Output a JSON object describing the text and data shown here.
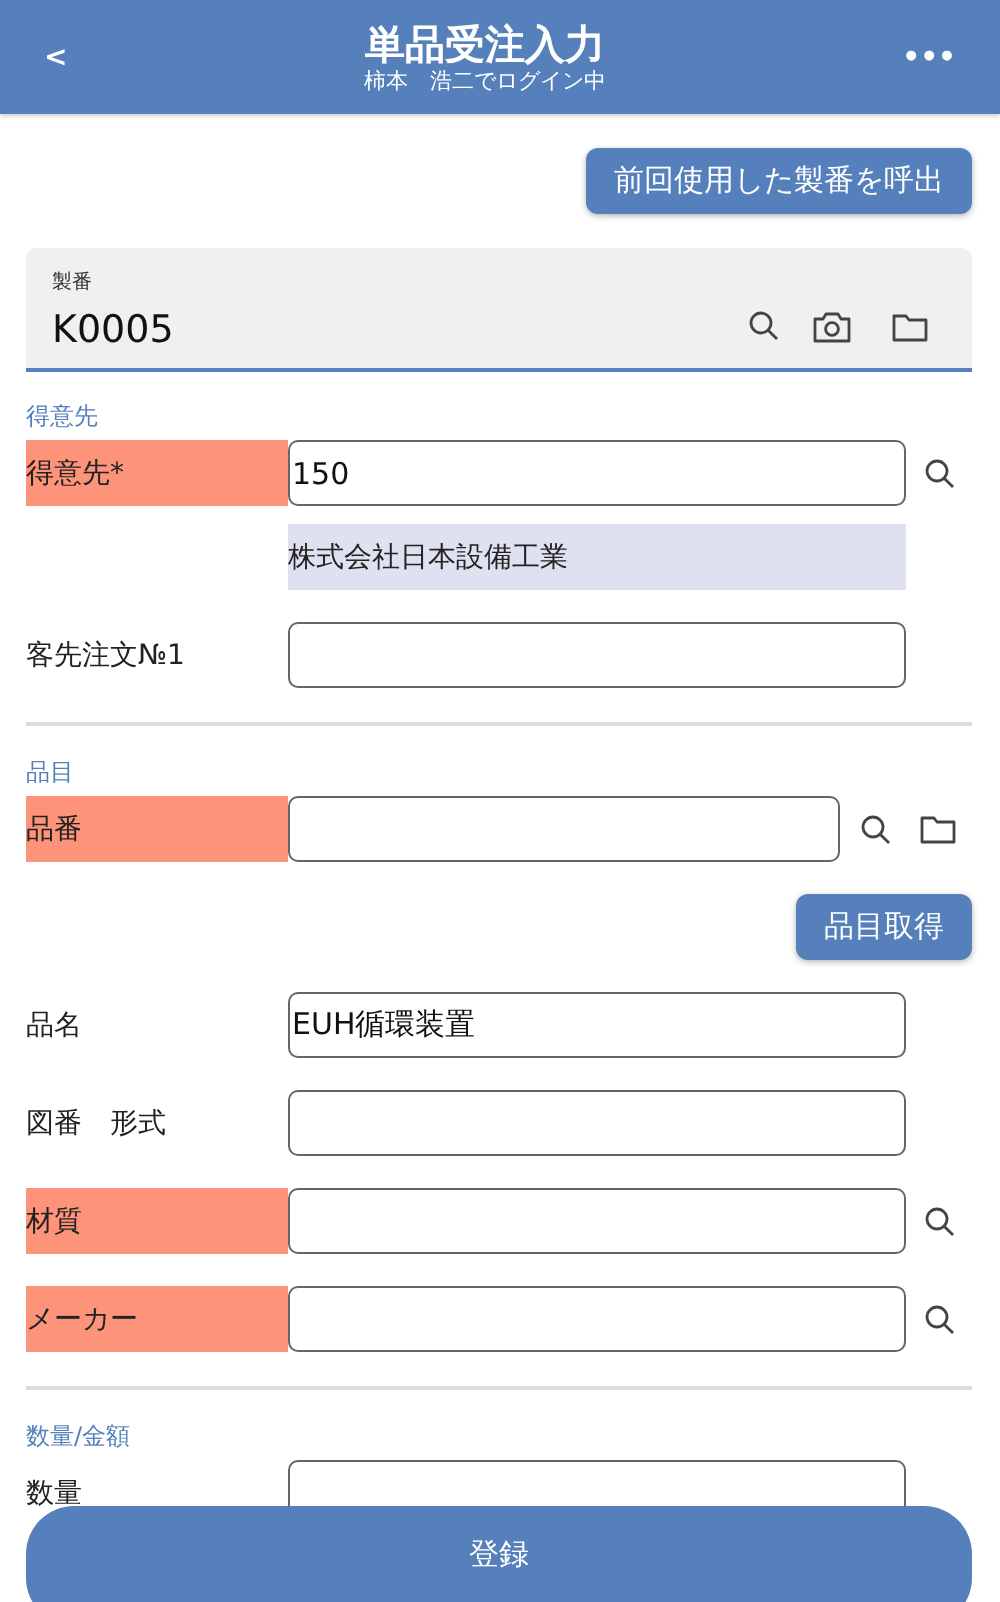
{
  "header": {
    "back": "<",
    "title": "単品受注入力",
    "subtitle": "柿本　浩二でログイン中",
    "menu": "•••"
  },
  "recall_button": "前回使用した製番を呼出",
  "serial_field": {
    "label": "製番",
    "value": "K0005",
    "search_button": true,
    "camera_button": true,
    "folder_button": true
  },
  "sections": [
    {
      "title": "得意先",
      "rows": [
        {
          "kind": "input",
          "label": "得意先*",
          "required": true,
          "value": "150",
          "search_button": true,
          "folder_button": false
        },
        {
          "kind": "display",
          "value": "株式会社日本設備工業"
        },
        {
          "kind": "input",
          "label": "客先注文№1",
          "required": false,
          "value": "",
          "search_button": false,
          "folder_button": false
        }
      ]
    },
    {
      "title": "品目",
      "rows": [
        {
          "kind": "input",
          "label": "品番",
          "required": true,
          "value": "",
          "search_button": true,
          "folder_button": true
        },
        {
          "kind": "action",
          "label": "品目取得"
        },
        {
          "kind": "input",
          "label": "品名",
          "required": false,
          "value": "EUH循環装置",
          "search_button": false,
          "folder_button": false
        },
        {
          "kind": "input",
          "label": "図番　形式",
          "required": false,
          "value": "",
          "search_button": false,
          "folder_button": false
        },
        {
          "kind": "input",
          "label": "材質",
          "required": true,
          "value": "",
          "search_button": true,
          "folder_button": false
        },
        {
          "kind": "input",
          "label": "メーカー",
          "required": true,
          "value": "",
          "search_button": true,
          "folder_button": false
        }
      ]
    },
    {
      "title": "数量/金額",
      "rows": [
        {
          "kind": "input",
          "label": "数量",
          "required": false,
          "value": "",
          "search_button": false,
          "folder_button": false
        }
      ]
    }
  ],
  "submit_button": "登録"
}
